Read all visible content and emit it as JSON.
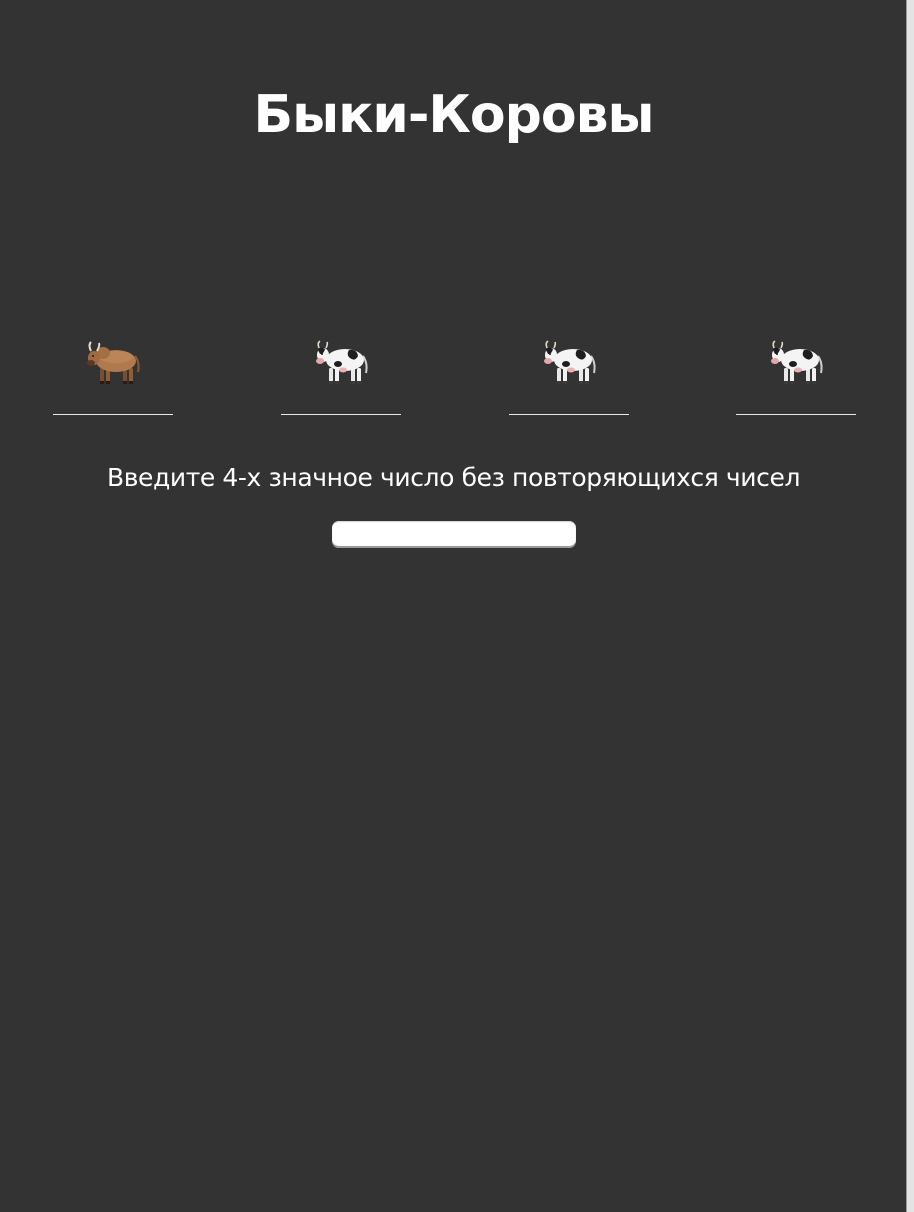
{
  "header": {
    "title": "Быки-Коровы"
  },
  "slots": [
    {
      "animal_icon": "bull-icon",
      "value": ""
    },
    {
      "animal_icon": "cow-icon",
      "value": ""
    },
    {
      "animal_icon": "cow-icon",
      "value": ""
    },
    {
      "animal_icon": "cow-icon",
      "value": ""
    }
  ],
  "prompt": {
    "text": "Введите 4-х значное число без повторяющихся чисел"
  },
  "guess": {
    "value": "",
    "placeholder": ""
  },
  "colors": {
    "background": "#333333",
    "text": "#ffffff",
    "bull_body": "#b07a4e",
    "cow_body": "#f4f4f4",
    "cow_spots": "#1e1e1e",
    "udder": "#eab0b6"
  }
}
